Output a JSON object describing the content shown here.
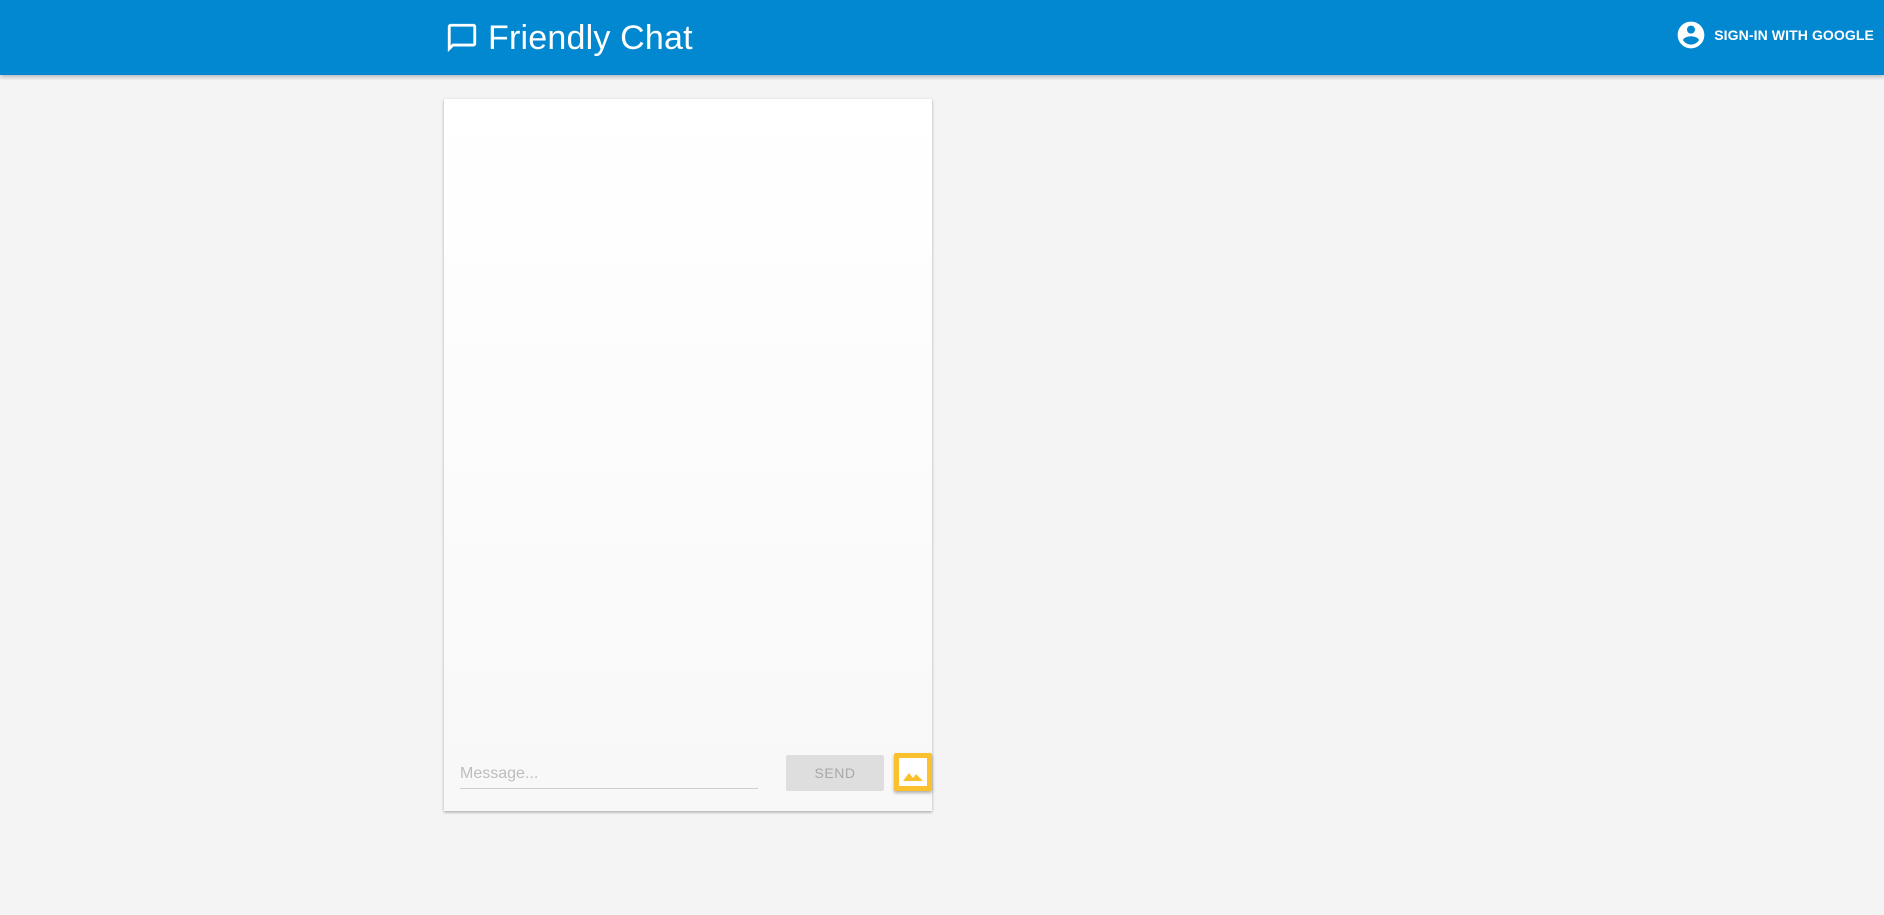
{
  "header": {
    "title": "Friendly Chat",
    "signin_label": "SIGN-IN WITH GOOGLE",
    "background_color": "#0288d1",
    "icons": {
      "brand": "chat-bubble-icon",
      "account": "account-circle-icon"
    }
  },
  "composer": {
    "message_placeholder": "Message...",
    "message_value": "",
    "send_label": "SEND",
    "image_button_icon": "image-icon",
    "image_button_color": "#fbc02d"
  }
}
